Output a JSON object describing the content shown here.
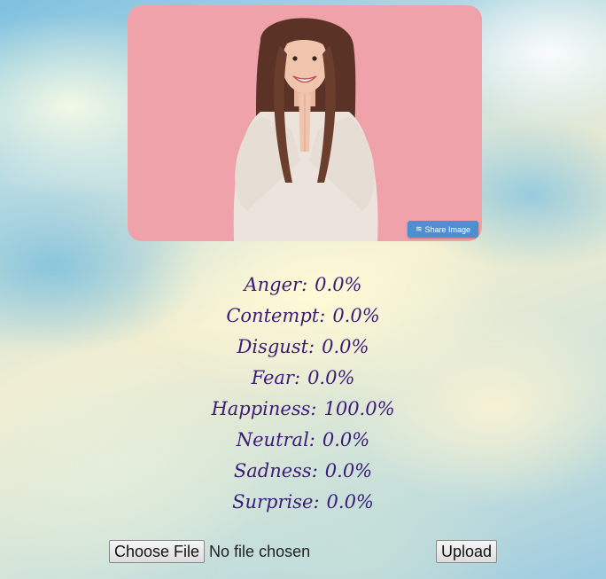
{
  "photo": {
    "share_label": "Share Image",
    "share_icon": "layers-icon",
    "background_color": "#f0a2ab"
  },
  "emotions": [
    {
      "name": "Anger",
      "value": "0.0%"
    },
    {
      "name": "Contempt",
      "value": "0.0%"
    },
    {
      "name": "Disgust",
      "value": "0.0%"
    },
    {
      "name": "Fear",
      "value": "0.0%"
    },
    {
      "name": "Happiness",
      "value": "100.0%"
    },
    {
      "name": "Neutral",
      "value": "0.0%"
    },
    {
      "name": "Sadness",
      "value": "0.0%"
    },
    {
      "name": "Surprise",
      "value": "0.0%"
    }
  ],
  "form": {
    "choose_file_label": "Choose File",
    "file_status": "No file chosen",
    "upload_label": "Upload"
  },
  "colors": {
    "emotion_text": "#3d1a7a",
    "share_button": "#4f8fd0"
  }
}
